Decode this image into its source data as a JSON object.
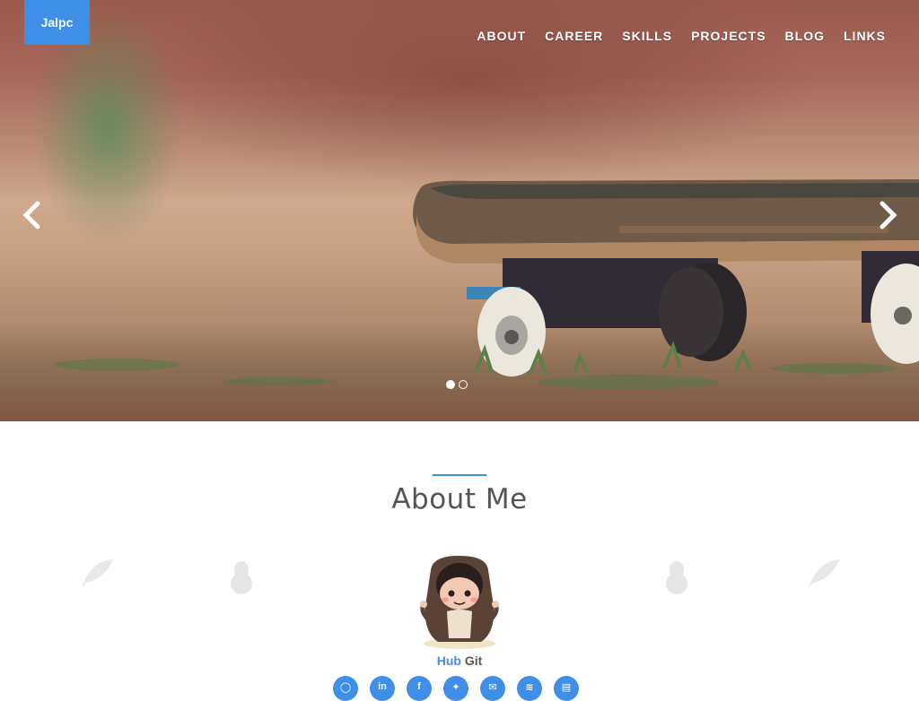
{
  "brand": {
    "label": "Jalpc"
  },
  "nav": {
    "items": [
      "ABOUT",
      "CAREER",
      "SKILLS",
      "PROJECTS",
      "BLOG",
      "LINKS"
    ]
  },
  "carousel": {
    "slide_count": 2,
    "active_slide": 1
  },
  "about": {
    "title": "About Me"
  },
  "profile": {
    "hub_word": "Hub",
    "git_word": "Git"
  },
  "socials": [
    {
      "icon": "github-icon",
      "glyph": "◯"
    },
    {
      "icon": "linkedin-icon",
      "glyph": "in"
    },
    {
      "icon": "facebook-icon",
      "glyph": "f"
    },
    {
      "icon": "twitter-icon",
      "glyph": "✦"
    },
    {
      "icon": "email-icon",
      "glyph": "✉"
    },
    {
      "icon": "rss-icon",
      "glyph": "≋"
    },
    {
      "icon": "resume-icon",
      "glyph": "▤"
    }
  ],
  "colors": {
    "accent": "#3f8fe8",
    "text": "#555555"
  }
}
